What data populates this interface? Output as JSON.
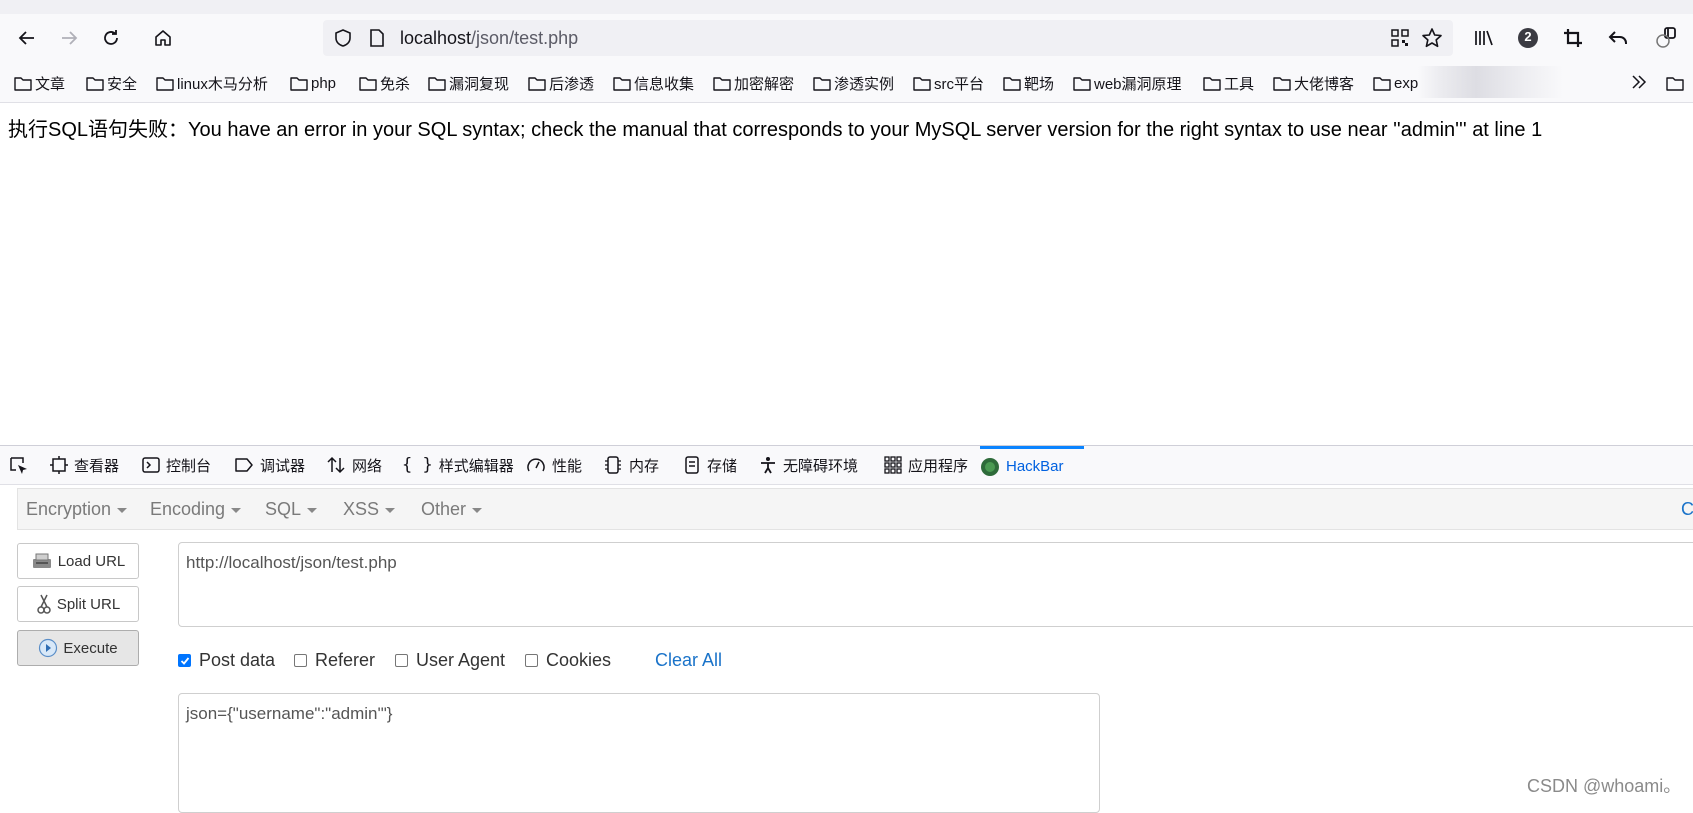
{
  "browser": {
    "url_host": "localhost",
    "url_path": "/json/test.php",
    "badge_count": "2",
    "icons": [
      "back-arrow-icon",
      "forward-arrow-icon",
      "reload-icon",
      "home-icon",
      "shield-icon",
      "page-icon",
      "qr-code-icon",
      "star-icon",
      "library-icon",
      "account-badge-icon",
      "crop-icon",
      "undo-icon",
      "extension-icon"
    ]
  },
  "bookmarks": [
    "文章",
    "安全",
    "linux木马分析",
    "php",
    "免杀",
    "漏洞复现",
    "后渗透",
    "信息收集",
    "加密解密",
    "渗透实例",
    "src平台",
    "靶场",
    "web漏洞原理",
    "工具",
    "大佬博客",
    "exp"
  ],
  "page": {
    "error_message": "执行SQL语句失败：You have an error in your SQL syntax; check the manual that corresponds to your MySQL server version for the right syntax to use near ''admin''' at line 1"
  },
  "devtools": {
    "tabs": [
      "查看器",
      "控制台",
      "调试器",
      "网络",
      "样式编辑器",
      "性能",
      "内存",
      "存储",
      "无障碍环境",
      "应用程序",
      "HackBar"
    ],
    "active_tab": "HackBar"
  },
  "hackbar": {
    "menu": [
      "Encryption",
      "Encoding",
      "SQL",
      "XSS",
      "Other"
    ],
    "menu_right": "C",
    "buttons": {
      "load": "Load URL",
      "split": "Split URL",
      "execute": "Execute"
    },
    "url_value": "http://localhost/json/test.php",
    "options": [
      {
        "label": "Post data",
        "checked": true
      },
      {
        "label": "Referer",
        "checked": false
      },
      {
        "label": "User Agent",
        "checked": false
      },
      {
        "label": "Cookies",
        "checked": false
      }
    ],
    "clear_all": "Clear All",
    "post_value": "json={\"username\":\"admin'\"}"
  },
  "watermark": "CSDN @whoami。",
  "colors": {
    "accent": "#0a84ff",
    "link": "#1a73c9",
    "checkbox": "#0075ff"
  }
}
